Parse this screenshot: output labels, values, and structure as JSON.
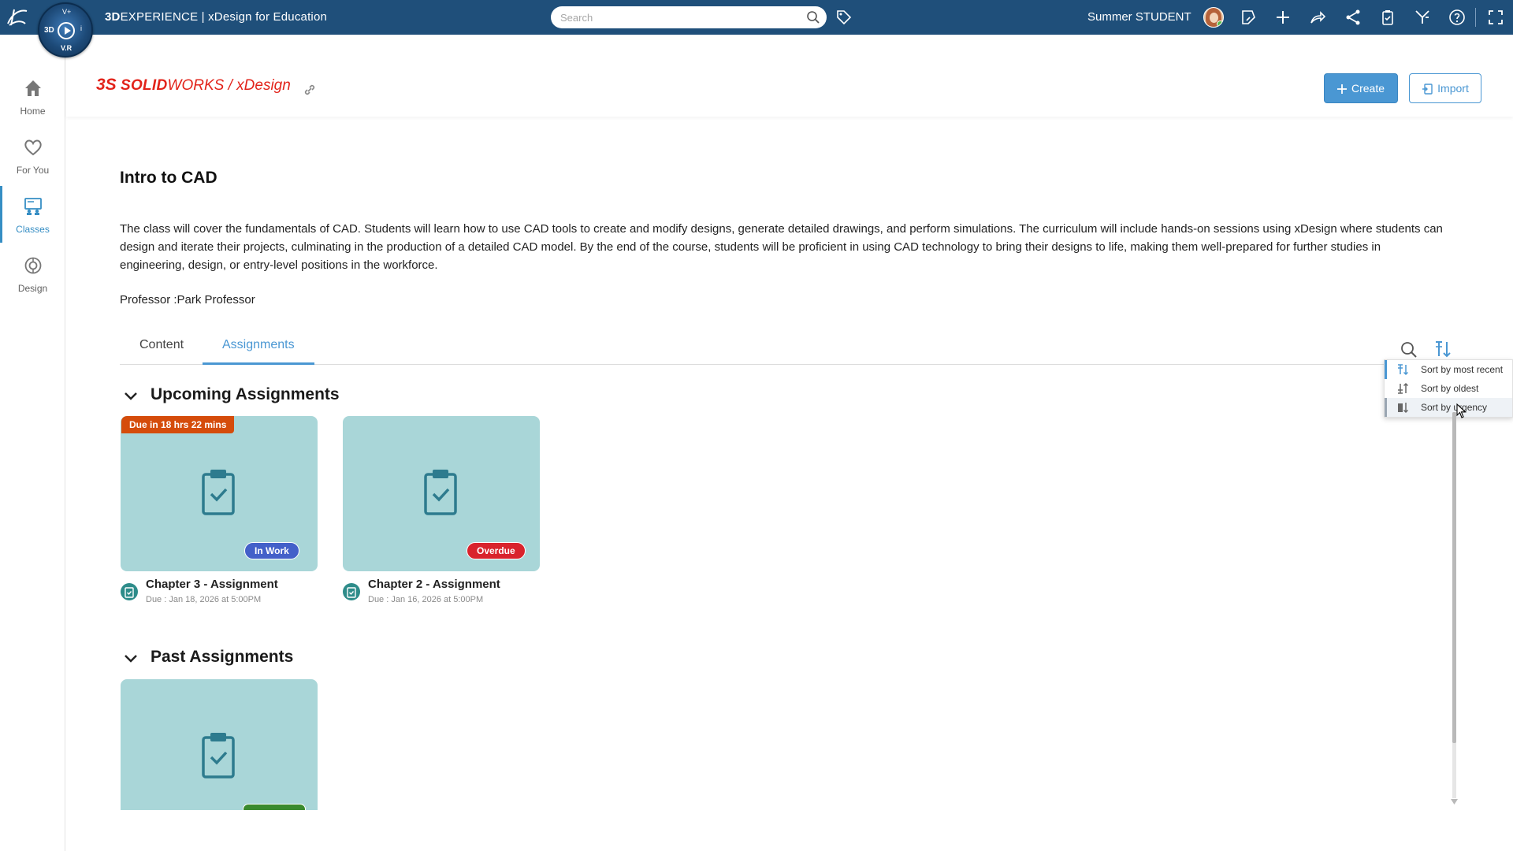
{
  "topbar": {
    "title_bold": "3D",
    "title_rest": "EXPERIENCE | xDesign for Education",
    "compass": {
      "top": "V+",
      "left": "3D",
      "right": "i",
      "bottom": "V.R"
    },
    "search_placeholder": "Search",
    "user_name": "Summer STUDENT"
  },
  "sidebar": {
    "items": [
      {
        "label": "Home",
        "icon": "home-icon"
      },
      {
        "label": "For You",
        "icon": "heart-icon"
      },
      {
        "label": "Classes",
        "icon": "classes-icon",
        "active": true
      },
      {
        "label": "Design",
        "icon": "design-icon"
      }
    ]
  },
  "brand": {
    "ds": "3S",
    "solid": "SOLID",
    "works": "WORKS",
    "slash": " / ",
    "product": "xDesign"
  },
  "actions": {
    "create_label": "Create",
    "import_label": "Import"
  },
  "class": {
    "title": "Intro to CAD",
    "description": "The class will cover the fundamentals of CAD. Students will learn how to use CAD tools to create and modify designs, generate detailed drawings, and perform simulations. The curriculum will include hands-on sessions using xDesign where students can design and iterate their projects, culminating in the production of a detailed CAD model. By the end of the course, students will be proficient in using CAD technology to bring their designs to life, making them well-prepared for further studies in engineering, design, or entry-level positions in the workforce.",
    "professor": "Professor :Park Professor"
  },
  "tabs": [
    {
      "label": "Content",
      "active": false
    },
    {
      "label": "Assignments",
      "active": true
    }
  ],
  "upcoming": {
    "heading": "Upcoming Assignments",
    "cards": [
      {
        "banner": "Due in 18 hrs 22 mins",
        "status": "In Work",
        "title": "Chapter 3 - Assignment",
        "due": "Due : Jan 18, 2026 at 5:00PM"
      },
      {
        "banner": "",
        "status": "Overdue",
        "title": "Chapter 2 - Assignment",
        "due": "Due : Jan 16, 2026 at 5:00PM"
      }
    ]
  },
  "past": {
    "heading": "Past Assignments"
  },
  "sort_menu": {
    "items": [
      {
        "label": "Sort by most recent",
        "selected": true
      },
      {
        "label": "Sort by oldest",
        "selected": false
      },
      {
        "label": "Sort by urgency",
        "selected": false,
        "hover": true
      }
    ]
  },
  "colors": {
    "topbar": "#1f4f7a",
    "accent": "#4a97d3",
    "brand_red": "#e2231a",
    "card_bg": "#a9d6d8",
    "in_work": "#4360c9",
    "overdue": "#d9232c",
    "due_banner": "#d54c0b"
  }
}
